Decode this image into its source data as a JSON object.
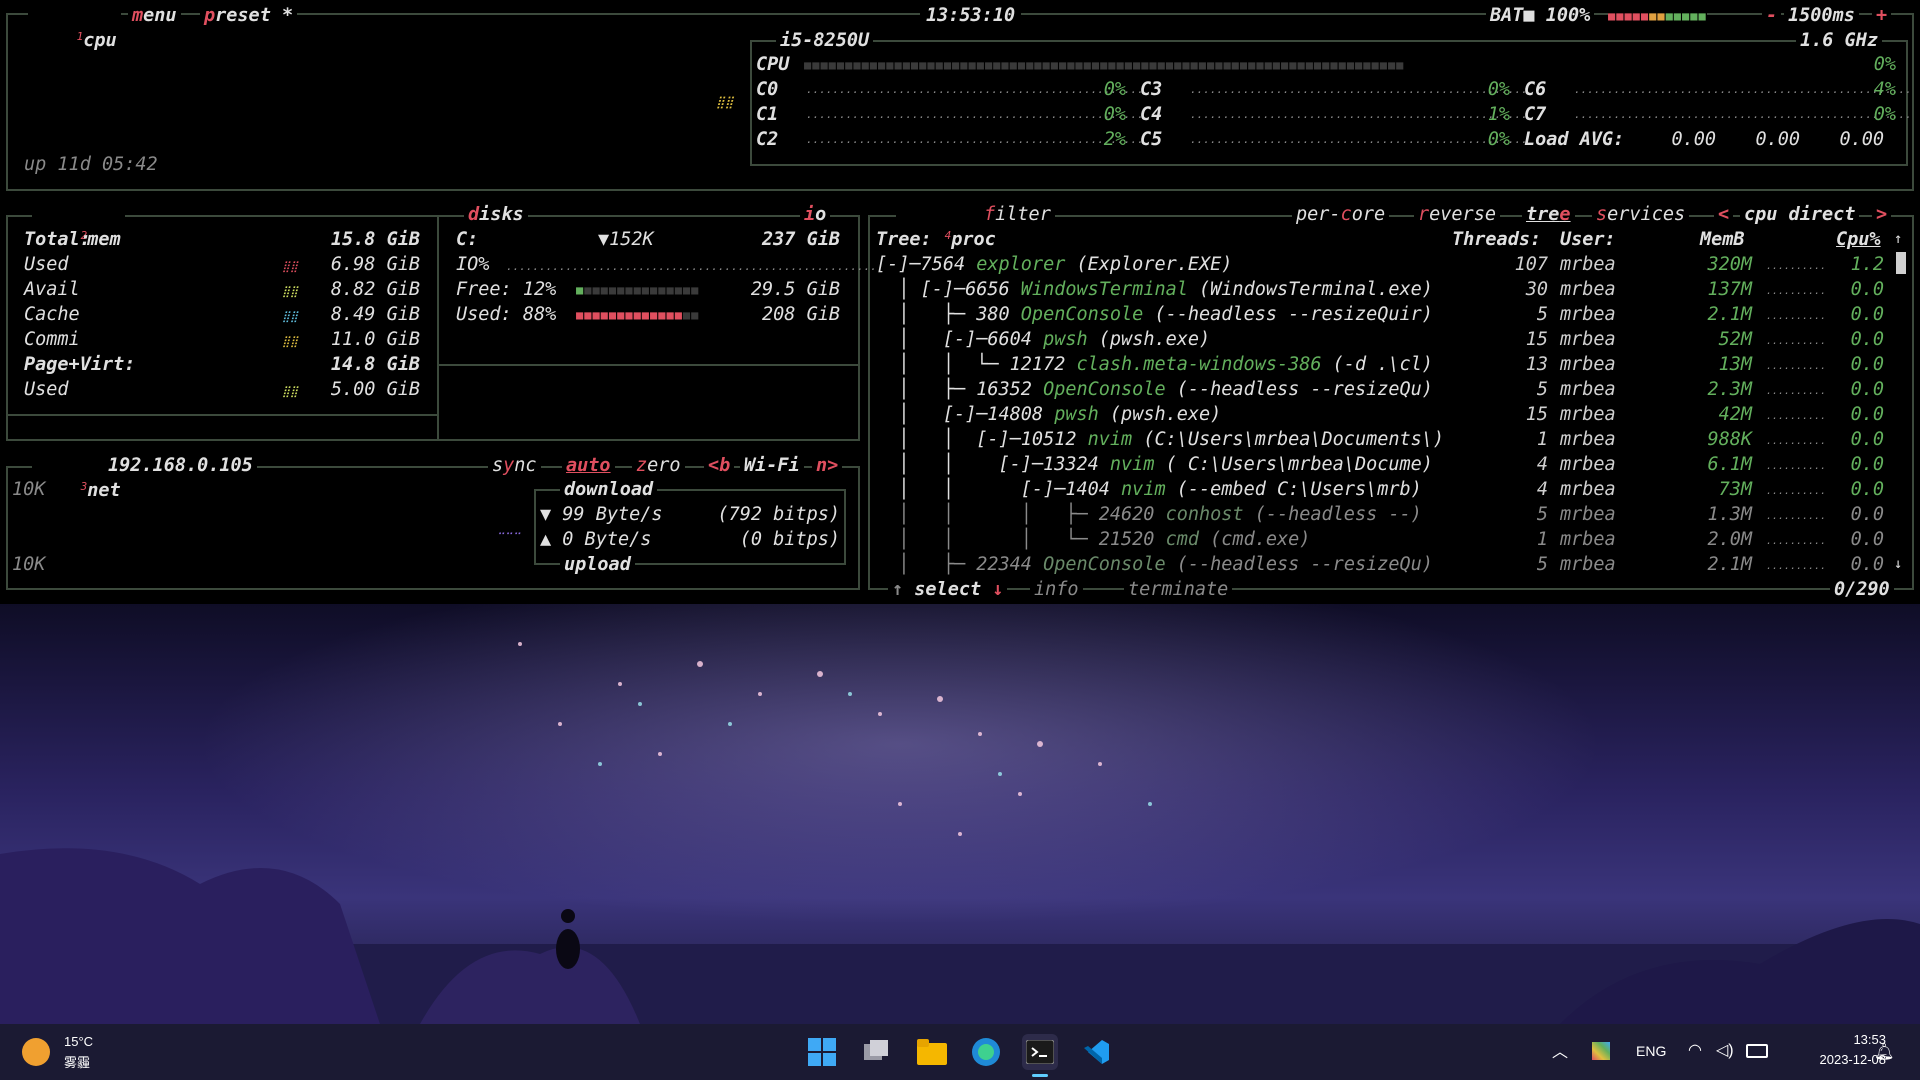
{
  "cpu_box": {
    "idx": "1",
    "title": "cpu",
    "menu": "menu",
    "preset": "preset *",
    "clock": "13:53:10",
    "battery": "BAT■ 100%",
    "interval": "1500ms",
    "minus": "-",
    "plus": "+",
    "model": "i5-8250U",
    "freq": "1.6 GHz",
    "uptime": "up 11d 05:42",
    "cpu_label": "CPU",
    "cpu_total": "0%",
    "cores": [
      {
        "name": "C0",
        "pct": "0%"
      },
      {
        "name": "C1",
        "pct": "0%"
      },
      {
        "name": "C2",
        "pct": "2%"
      },
      {
        "name": "C3",
        "pct": "0%"
      },
      {
        "name": "C4",
        "pct": "1%"
      },
      {
        "name": "C5",
        "pct": "0%"
      },
      {
        "name": "C6",
        "pct": "4%"
      },
      {
        "name": "C7",
        "pct": "0%"
      }
    ],
    "load_label": "Load AVG:",
    "load": [
      "0.00",
      "0.00",
      "0.00"
    ]
  },
  "mem_box": {
    "idx": "2",
    "title": "mem",
    "rows": [
      {
        "label": "Total:",
        "value": "15.8 GiB"
      },
      {
        "label": "Used",
        "value": "6.98 GiB"
      },
      {
        "label": "Avail",
        "value": "8.82 GiB"
      },
      {
        "label": "Cache",
        "value": "8.49 GiB"
      },
      {
        "label": "Commi",
        "value": "11.0 GiB"
      },
      {
        "label": "Page+Virt:",
        "value": "14.8 GiB"
      },
      {
        "label": "Used",
        "value": "5.00 GiB"
      }
    ]
  },
  "disks_box": {
    "title": "disks",
    "io": "io",
    "drive": "C:",
    "rate": "▼152K",
    "size": "237 GiB",
    "io_label": "IO%",
    "free_label": "Free: 12%",
    "free_value": "29.5 GiB",
    "used_label": "Used: 88%",
    "used_value": "208 GiB",
    "free_fraction": 0.12,
    "used_fraction": 0.88
  },
  "net_box": {
    "idx": "3",
    "title": "net",
    "ip": "192.168.0.105",
    "sync": "sync",
    "auto": "auto",
    "zero": "zero",
    "prev": "<b",
    "iface": "Wi-Fi",
    "next": "n>",
    "scale_top": "10K",
    "scale_bottom": "10K",
    "download_label": "download",
    "down_rate": "▼ 99 Byte/s",
    "down_bits": "(792 bitps)",
    "up_rate": "▲ 0 Byte/s",
    "up_bits": "(0 bitps)",
    "upload_label": "upload"
  },
  "proc_box": {
    "idx": "4",
    "title": "proc",
    "filter": "filter",
    "per_core": "per-core",
    "reverse": "reverse",
    "tree": "tree",
    "services": "services",
    "sort_prev": "<",
    "sort": "cpu direct",
    "sort_next": ">",
    "headers": {
      "tree": "Tree:",
      "threads": "Threads:",
      "user": "User:",
      "mem": "MemB",
      "cpu": "Cpu%"
    },
    "rows": [
      {
        "prefix": "[-]─7564 ",
        "name": "explorer",
        "args": " (Explorer.EXE)",
        "threads": "107",
        "user": "mrbea",
        "mem": "320M",
        "cpu": "1.2"
      },
      {
        "prefix": "  │ [-]─6656 ",
        "name": "WindowsTerminal",
        "args": " (WindowsTerminal.exe)",
        "threads": "30",
        "user": "mrbea",
        "mem": "137M",
        "cpu": "0.0"
      },
      {
        "prefix": "  │   ├─ 380 ",
        "name": "OpenConsole",
        "args": " (--headless --resizeQuir)",
        "threads": "5",
        "user": "mrbea",
        "mem": "2.1M",
        "cpu": "0.0"
      },
      {
        "prefix": "  │   [-]─6604 ",
        "name": "pwsh",
        "args": " (pwsh.exe)",
        "threads": "15",
        "user": "mrbea",
        "mem": "52M",
        "cpu": "0.0"
      },
      {
        "prefix": "  │   │  └─ 12172 ",
        "name": "clash.meta-windows-386",
        "args": " (-d .\\cl)",
        "threads": "13",
        "user": "mrbea",
        "mem": "13M",
        "cpu": "0.0"
      },
      {
        "prefix": "  │   ├─ 16352 ",
        "name": "OpenConsole",
        "args": " (--headless --resizeQu)",
        "threads": "5",
        "user": "mrbea",
        "mem": "2.3M",
        "cpu": "0.0"
      },
      {
        "prefix": "  │   [-]─14808 ",
        "name": "pwsh",
        "args": " (pwsh.exe)",
        "threads": "15",
        "user": "mrbea",
        "mem": "42M",
        "cpu": "0.0"
      },
      {
        "prefix": "  │   │  [-]─10512 ",
        "name": "nvim",
        "args": " (C:\\Users\\mrbea\\Documents\\)",
        "threads": "1",
        "user": "mrbea",
        "mem": "988K",
        "cpu": "0.0"
      },
      {
        "prefix": "  │   │    [-]─13324 ",
        "name": "nvim",
        "args": " ( C:\\Users\\mrbea\\Docume)",
        "threads": "4",
        "user": "mrbea",
        "mem": "6.1M",
        "cpu": "0.0"
      },
      {
        "prefix": "  │   │      [-]─1404 ",
        "name": "nvim",
        "args": " (--embed C:\\Users\\mrb)",
        "threads": "4",
        "user": "mrbea",
        "mem": "73M",
        "cpu": "0.0"
      },
      {
        "prefix": "  │   │      │   ├─ 24620 ",
        "name": "conhost",
        "args": " (--headless --)",
        "threads": "5",
        "user": "mrbea",
        "mem": "1.3M",
        "cpu": "0.0"
      },
      {
        "prefix": "  │   │      │   └─ 21520 ",
        "name": "cmd",
        "args": " (cmd.exe)",
        "threads": "1",
        "user": "mrbea",
        "mem": "2.0M",
        "cpu": "0.0"
      },
      {
        "prefix": "  │   ├─ 22344 ",
        "name": "OpenConsole",
        "args": " (--headless --resizeQu)",
        "threads": "5",
        "user": "mrbea",
        "mem": "2.1M",
        "cpu": "0.0"
      }
    ],
    "select": "select",
    "info": "info",
    "terminate": "terminate",
    "count": "0/290"
  },
  "taskbar": {
    "weather_temp": "15°C",
    "weather_desc": "雾霾",
    "lang": "ENG",
    "time": "13:53",
    "date": "2023-12-08",
    "apps": [
      "start-icon",
      "task-view-icon",
      "file-explorer-icon",
      "edge-icon",
      "terminal-icon",
      "vscode-icon"
    ]
  },
  "colors": {
    "border": "#3c4a3c",
    "accent": "#e04f5f",
    "green": "#63b05d",
    "taskbar": "#1b1a33"
  }
}
